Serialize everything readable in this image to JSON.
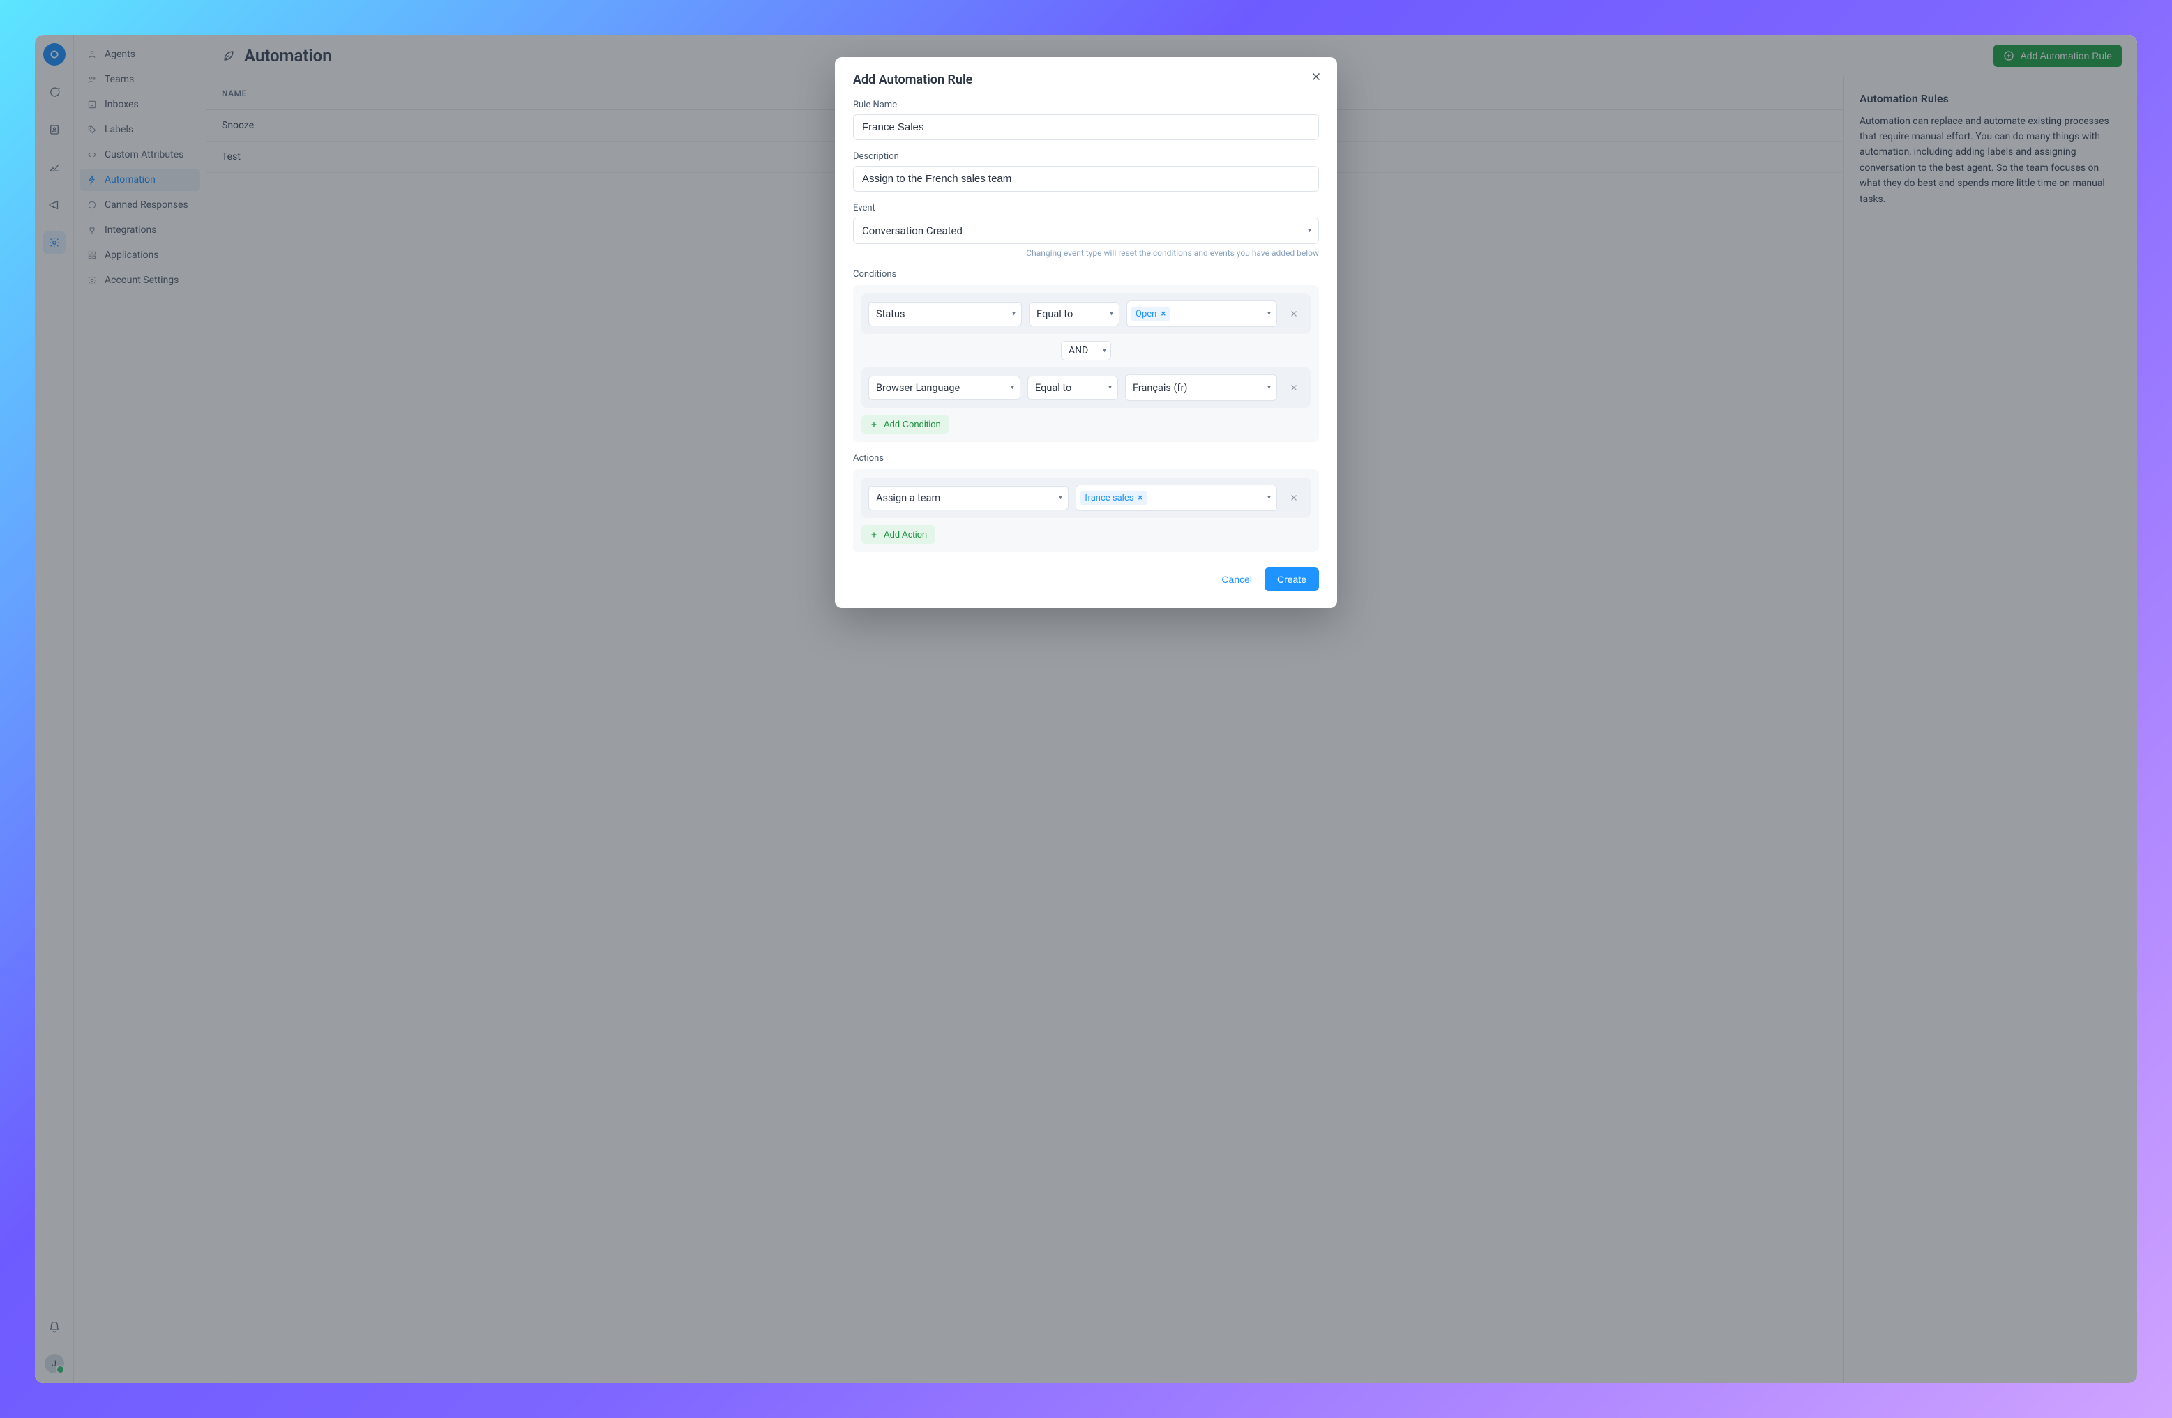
{
  "rail": {
    "avatar_initial": "J"
  },
  "sidebar": {
    "items": [
      {
        "label": "Agents"
      },
      {
        "label": "Teams"
      },
      {
        "label": "Inboxes"
      },
      {
        "label": "Labels"
      },
      {
        "label": "Custom Attributes"
      },
      {
        "label": "Automation"
      },
      {
        "label": "Canned Responses"
      },
      {
        "label": "Integrations"
      },
      {
        "label": "Applications"
      },
      {
        "label": "Account Settings"
      }
    ]
  },
  "page": {
    "title": "Automation",
    "add_button": "Add Automation Rule",
    "table_header_name": "NAME",
    "rows": [
      {
        "name": "Snooze"
      },
      {
        "name": "Test"
      }
    ],
    "info_title": "Automation Rules",
    "info_body": "Automation can replace and automate existing processes that require manual effort. You can do many things with automation, including adding labels and assigning conversation to the best agent. So the team focuses on what they do best and spends more little time on manual tasks."
  },
  "modal": {
    "title": "Add Automation Rule",
    "rule_name_label": "Rule Name",
    "rule_name_value": "France Sales",
    "description_label": "Description",
    "description_value": "Assign to the French sales team",
    "event_label": "Event",
    "event_value": "Conversation Created",
    "event_hint": "Changing event type will reset the conditions and events you have added below",
    "conditions_label": "Conditions",
    "conditions": [
      {
        "field": "Status",
        "operator": "Equal to",
        "value_chip": "Open",
        "value_plain": null
      },
      {
        "field": "Browser Language",
        "operator": "Equal to",
        "value_chip": null,
        "value_plain": "Français (fr)"
      }
    ],
    "joiner": "AND",
    "add_condition_label": "Add Condition",
    "actions_label": "Actions",
    "actions": [
      {
        "type": "Assign a team",
        "value_chip": "france sales"
      }
    ],
    "add_action_label": "Add Action",
    "cancel_label": "Cancel",
    "create_label": "Create"
  }
}
